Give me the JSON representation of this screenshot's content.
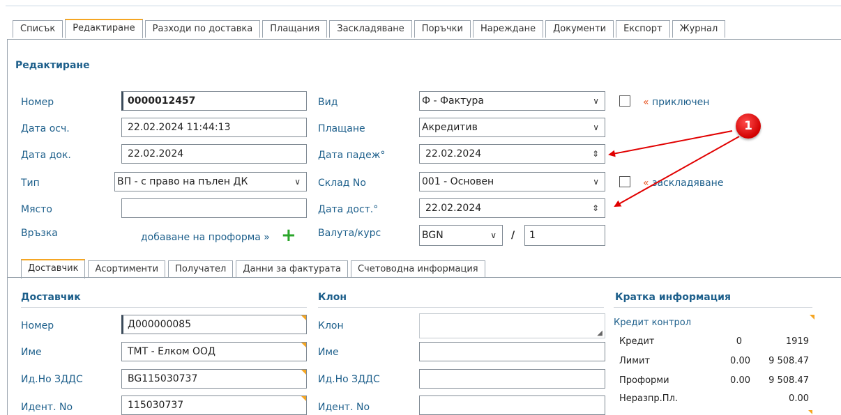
{
  "tabs": [
    "Списък",
    "Редактиране",
    "Разходи по доставка",
    "Плащания",
    "Заскладяване",
    "Поръчки",
    "Нареждане",
    "Документи",
    "Експорт",
    "Журнал"
  ],
  "active_tab": "Редактиране",
  "section_title": "Редактиране",
  "left": {
    "number_label": "Номер",
    "number_value": "0000012457",
    "date_calc_label": "Дата осч.",
    "date_calc_value": "22.02.2024 11:44:13",
    "date_doc_label": "Дата док.",
    "date_doc_value": "22.02.2024",
    "type_label": "Тип",
    "type_value": "ВП - с право на пълен ДК",
    "place_label": "Място",
    "place_value": "",
    "link_label": "Връзка",
    "add_proforma": "добаване на проформа »"
  },
  "middle": {
    "kind_label": "Вид",
    "kind_value": "Ф - Фактура",
    "payment_label": "Плащане",
    "payment_value": "Акредитив",
    "due_label": "Дата падеж°",
    "due_value": "22.02.2024",
    "warehouse_label": "Склад No",
    "warehouse_value": "001 - Основен",
    "delivery_label": "Дата дост.°",
    "delivery_value": "22.02.2024",
    "currency_label": "Валута/курс",
    "currency_value": "BGN",
    "rate_sep": "/",
    "rate_value": "1"
  },
  "right": {
    "closed_prefix": "«",
    "closed_label": "приключен",
    "stocking_prefix": "«",
    "stocking_label": "заскладяване"
  },
  "subtabs": [
    "Доставчик",
    "Асортименти",
    "Получател",
    "Данни за фактурата",
    "Счетоводна информация"
  ],
  "active_subtab": "Доставчик",
  "supplier": {
    "title": "Доставчик",
    "number_label": "Номер",
    "number_value": "Д000000085",
    "name_label": "Име",
    "name_value": "ТМТ - Елком ООД",
    "vat_label": "Ид.Но ЗДДС",
    "vat_value": "BG115030737",
    "ident_label": "Идент. No",
    "ident_value": "115030737"
  },
  "branch": {
    "title": "Клон",
    "branch_label": "Клон",
    "branch_value": "",
    "name_label": "Име",
    "name_value": "",
    "vat_label": "Ид.Но ЗДДС",
    "vat_value": "",
    "ident_label": "Идент. No",
    "ident_value": ""
  },
  "info": {
    "title": "Кратка информация",
    "credit_control": "Кредит контрол",
    "rows": [
      {
        "label": "Кредит",
        "v1": "0",
        "v2": "1919"
      },
      {
        "label": "Лимит",
        "v1": "0.00",
        "v2": "9 508.47"
      },
      {
        "label": "Проформи",
        "v1": "0.00",
        "v2": "9 508.47"
      },
      {
        "label": "Неразпр.Пл.",
        "v1": "",
        "v2": "0.00"
      }
    ]
  },
  "callout": {
    "number": "1"
  },
  "colors": {
    "accent": "#f5a623",
    "label": "#1d5f8b",
    "warning": "#e8531f",
    "callout": "#e10000",
    "plus": "#2aa52a"
  }
}
